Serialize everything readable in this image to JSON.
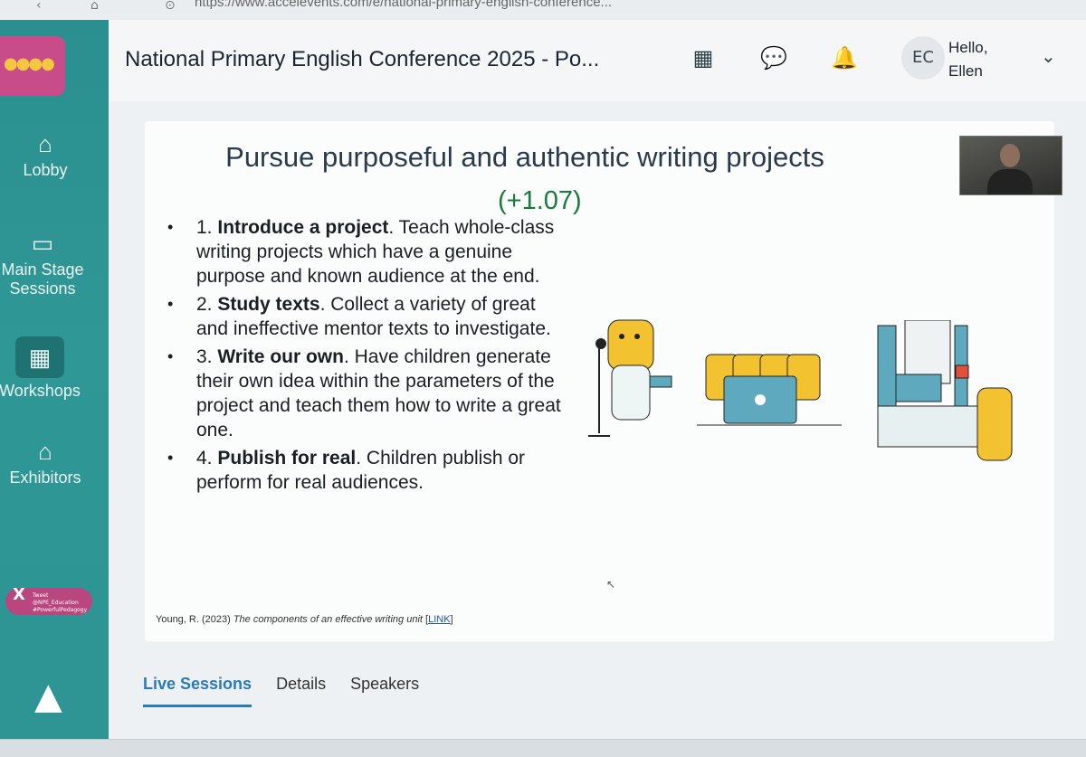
{
  "browser": {
    "url": "https://www.accelevents.com/e/national-primary-english-conference..."
  },
  "header": {
    "title": "National Primary English Conference 2025 - Po...",
    "avatar_initials": "EC",
    "greeting": "Hello,",
    "user_name": "Ellen"
  },
  "sidebar": {
    "items": [
      {
        "label": "Lobby",
        "icon": "home-icon"
      },
      {
        "label": "Main Stage Sessions",
        "icon": "video-icon"
      },
      {
        "label": "Workshops",
        "icon": "calendar-icon"
      },
      {
        "label": "Exhibitors",
        "icon": "store-icon"
      }
    ],
    "tweet_badge": "Tweet @NPE_Education #PowerfulPedagogy"
  },
  "slide": {
    "title": "Pursue purposeful and authentic writing projects",
    "stat": "(+1.07)",
    "bullets": [
      {
        "num": "1.",
        "bold": "Introduce a project",
        "text": ". Teach whole-class writing projects which have a genuine purpose and known audience at the end."
      },
      {
        "num": "2.",
        "bold": "Study texts",
        "text": ". Collect a variety of great and ineffective mentor texts to investigate."
      },
      {
        "num": "3.",
        "bold": "Write our own",
        "text": ". Have children generate their own idea within the parameters of the project and teach them how to write a great one."
      },
      {
        "num": "4.",
        "bold": "Publish for real",
        "text": ". Children publish or perform for real audiences."
      }
    ],
    "citation": {
      "author": "Young, R. (2023)",
      "title": "The components of an effective writing unit",
      "link": "LINK"
    }
  },
  "tabs": [
    "Live Sessions",
    "Details",
    "Speakers"
  ],
  "colors": {
    "sidebar": "#2e9494",
    "accent": "#2a79b8",
    "stat_green": "#1a7a3a",
    "logo_bg": "#c84b8a"
  }
}
